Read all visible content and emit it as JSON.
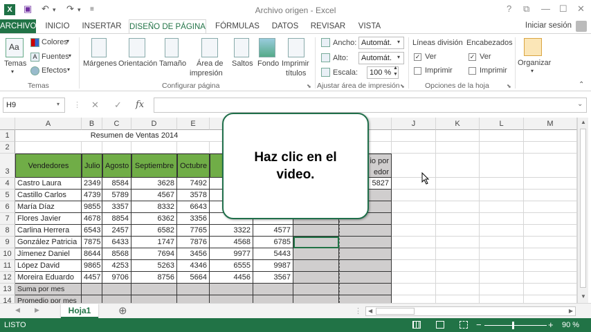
{
  "window": {
    "title": "Archivo origen - Excel",
    "logo": "X",
    "undo": "↶",
    "redo": "↷",
    "save": "💾",
    "customize": "⏷",
    "help": "?",
    "restore": "⧉",
    "minimize": "—",
    "maximize": "☐",
    "close": "✕",
    "signin": "Iniciar sesión"
  },
  "tabs": [
    "ARCHIVO",
    "INICIO",
    "INSERTAR",
    "DISEÑO DE PÁGINA",
    "FÓRMULAS",
    "DATOS",
    "REVISAR",
    "VISTA"
  ],
  "ribbon": {
    "temas": {
      "themes": "Temas",
      "colors": "Colores",
      "fonts": "Fuentes",
      "effects": "Efectos",
      "group": "Temas"
    },
    "page": {
      "margins": "Márgenes",
      "orientation": "Orientación",
      "size": "Tamaño",
      "print_area_1": "Área de",
      "print_area_2": "impresión",
      "breaks": "Saltos",
      "background": "Fondo",
      "print_titles_1": "Imprimir",
      "print_titles_2": "títulos",
      "group": "Configurar página"
    },
    "scale": {
      "width_label": "Ancho:",
      "width_value": "Automát.",
      "height_label": "Alto:",
      "height_value": "Automát.",
      "scale_label": "Escala:",
      "scale_value": "100 %",
      "group": "Ajustar área de impresión"
    },
    "sheet_options": {
      "gridlines": "Líneas división",
      "headings": "Encabezados",
      "view": "Ver",
      "print": "Imprimir",
      "group": "Opciones de la hoja"
    },
    "arrange": {
      "label": "Organizar"
    }
  },
  "formula_bar": {
    "name_box": "H9",
    "cancel": "✕",
    "enter": "✓",
    "fx": "fx",
    "formula": ""
  },
  "sheet": {
    "columns": [
      "A",
      "B",
      "C",
      "D",
      "E",
      "F",
      "G",
      "H",
      "I",
      "J",
      "K",
      "L",
      "M"
    ],
    "rows": [
      "1",
      "2",
      "3",
      "4",
      "5",
      "6",
      "7",
      "8",
      "9",
      "10",
      "11",
      "12",
      "13",
      "14"
    ],
    "title": "Resumen de Ventas 2014",
    "headers": [
      "Vendedores",
      "Julio",
      "Agosto",
      "Septiembre",
      "Octubre",
      "No"
    ],
    "partial_header_1": "io por",
    "partial_header_2": "edor",
    "data": [
      {
        "name": "Castro Laura",
        "v": [
          "2349",
          "8584",
          "3628",
          "7492",
          "",
          ""
        ],
        "h": "",
        "i": "5827"
      },
      {
        "name": "Castillo Carlos",
        "v": [
          "4739",
          "5789",
          "4567",
          "3578",
          "",
          ""
        ],
        "h": "",
        "i": ""
      },
      {
        "name": "María Díaz",
        "v": [
          "9855",
          "3357",
          "8332",
          "6643",
          "",
          ""
        ],
        "h": "",
        "i": ""
      },
      {
        "name": "Flores Javier",
        "v": [
          "4678",
          "8854",
          "6362",
          "3356",
          "",
          ""
        ],
        "h": "",
        "i": ""
      },
      {
        "name": "Carlina Herrera",
        "v": [
          "6543",
          "2457",
          "6582",
          "7765",
          "3322",
          "4577"
        ],
        "h": "",
        "i": ""
      },
      {
        "name": "González Patricia",
        "v": [
          "7875",
          "6433",
          "1747",
          "7876",
          "4568",
          "6785"
        ],
        "h": "",
        "i": ""
      },
      {
        "name": "Jímenez Daniel",
        "v": [
          "8644",
          "8568",
          "7694",
          "3456",
          "9977",
          "5443"
        ],
        "h": "",
        "i": ""
      },
      {
        "name": "López David",
        "v": [
          "9865",
          "4253",
          "5263",
          "4346",
          "6555",
          "9987"
        ],
        "h": "",
        "i": ""
      },
      {
        "name": "Moreira Eduardo",
        "v": [
          "4457",
          "9706",
          "8756",
          "5664",
          "4456",
          "3567"
        ],
        "h": "",
        "i": ""
      }
    ],
    "row13": "Suma por mes",
    "row14": "Promedio por mes"
  },
  "callout": {
    "text": "Haz clic en el video."
  },
  "sheetbar": {
    "sheet_name": "Hoja1",
    "add": "⊕",
    "prev": "◀",
    "next": "▶"
  },
  "status": {
    "mode": "LISTO",
    "zoom": "90 %",
    "minus": "−",
    "plus": "+"
  },
  "colors": {
    "excel_green": "#217346",
    "header_green": "#70ad47",
    "gray_fill": "#d0cece"
  }
}
